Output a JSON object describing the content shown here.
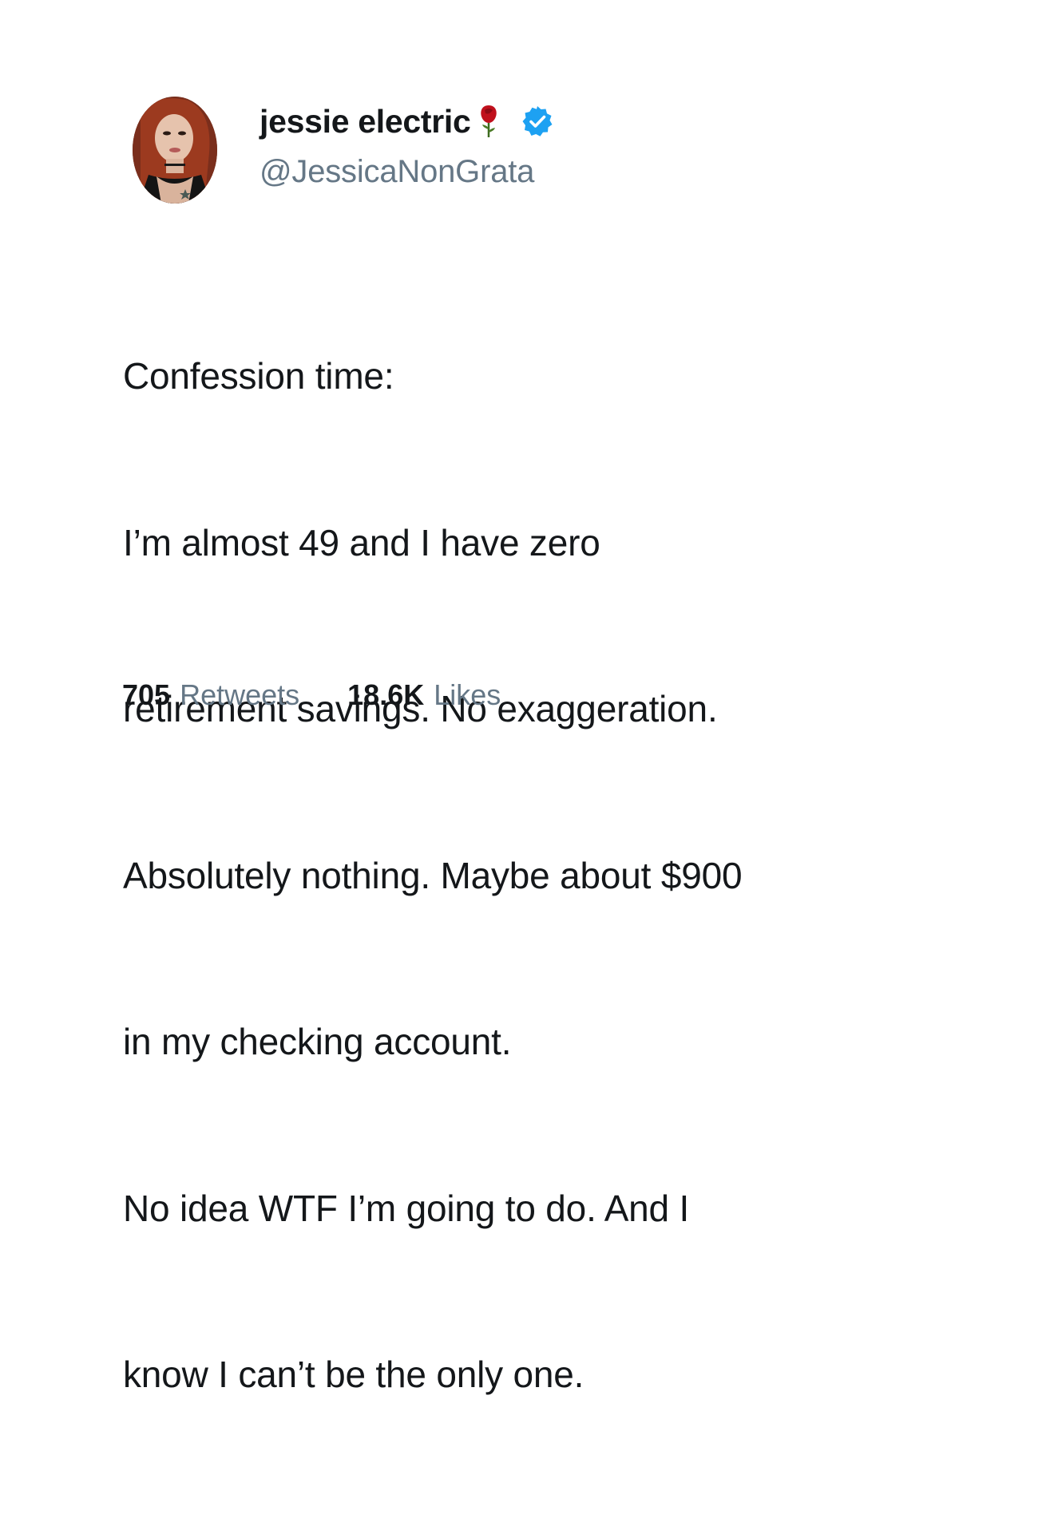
{
  "user": {
    "display_name": "jessie electric",
    "handle": "@JessicaNonGrata",
    "emoji_icon": "rose-icon",
    "verified_icon": "verified-badge-icon"
  },
  "tweet": {
    "lines": [
      "Confession time:",
      "I’m almost 49 and I have zero",
      "retirement savings. No exaggeration.",
      "Absolutely nothing. Maybe about $900",
      "in my checking account.",
      "No idea WTF I’m going to do. And I",
      "know I can’t be the only one."
    ]
  },
  "stats": {
    "retweets_count": "705",
    "retweets_label": "Retweets",
    "likes_count": "18.6K",
    "likes_label": "Likes"
  },
  "colors": {
    "text_primary": "#14171a",
    "text_secondary": "#657786",
    "verified_blue": "#1da1f2",
    "rose_red": "#c0101c"
  }
}
